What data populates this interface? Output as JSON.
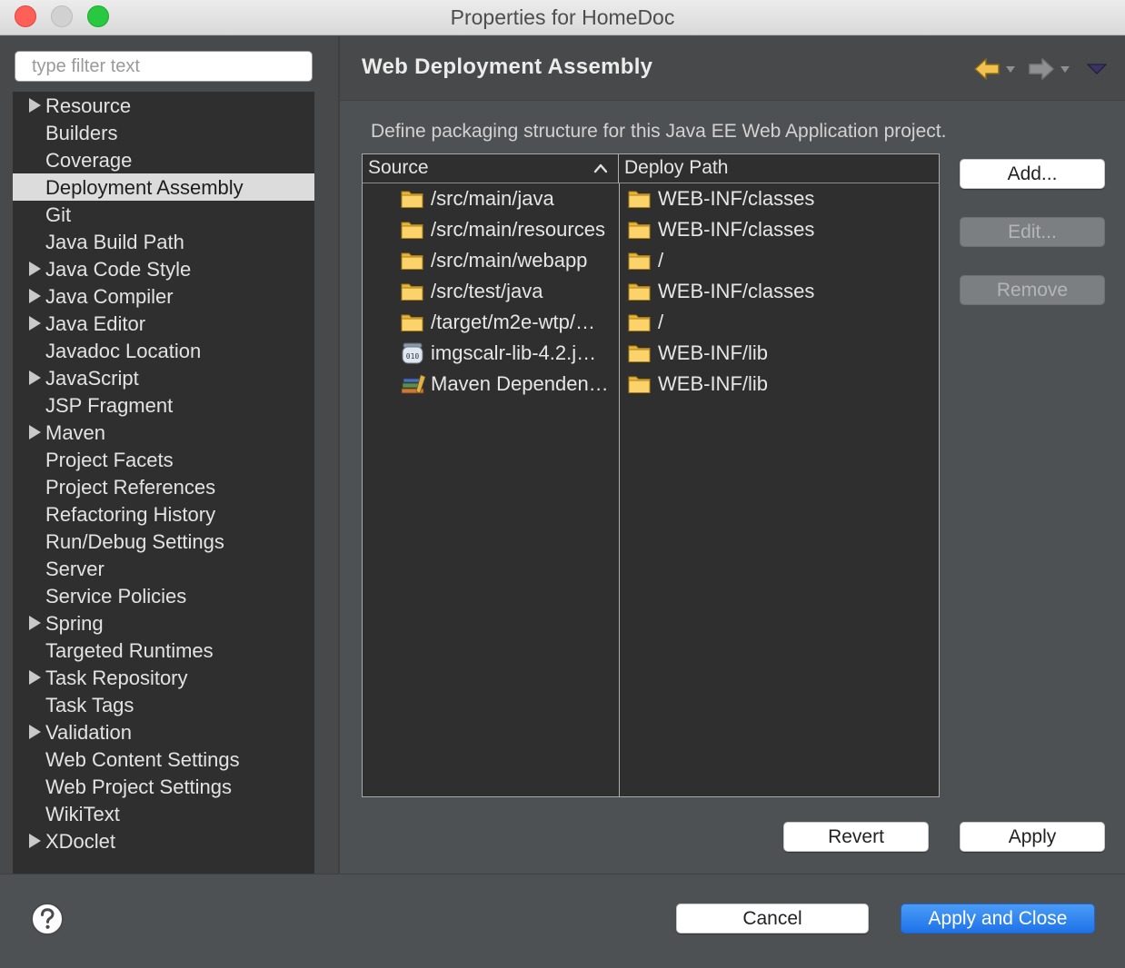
{
  "window": {
    "title": "Properties for HomeDoc"
  },
  "filter": {
    "placeholder": "type filter text",
    "value": ""
  },
  "sidebar": {
    "items": [
      {
        "label": "Resource",
        "expandable": true
      },
      {
        "label": "Builders",
        "expandable": false
      },
      {
        "label": "Coverage",
        "expandable": false
      },
      {
        "label": "Deployment Assembly",
        "expandable": false,
        "selected": true
      },
      {
        "label": "Git",
        "expandable": false
      },
      {
        "label": "Java Build Path",
        "expandable": false
      },
      {
        "label": "Java Code Style",
        "expandable": true
      },
      {
        "label": "Java Compiler",
        "expandable": true
      },
      {
        "label": "Java Editor",
        "expandable": true
      },
      {
        "label": "Javadoc Location",
        "expandable": false
      },
      {
        "label": "JavaScript",
        "expandable": true
      },
      {
        "label": "JSP Fragment",
        "expandable": false
      },
      {
        "label": "Maven",
        "expandable": true
      },
      {
        "label": "Project Facets",
        "expandable": false
      },
      {
        "label": "Project References",
        "expandable": false
      },
      {
        "label": "Refactoring History",
        "expandable": false
      },
      {
        "label": "Run/Debug Settings",
        "expandable": false
      },
      {
        "label": "Server",
        "expandable": false
      },
      {
        "label": "Service Policies",
        "expandable": false
      },
      {
        "label": "Spring",
        "expandable": true
      },
      {
        "label": "Targeted Runtimes",
        "expandable": false
      },
      {
        "label": "Task Repository",
        "expandable": true
      },
      {
        "label": "Task Tags",
        "expandable": false
      },
      {
        "label": "Validation",
        "expandable": true
      },
      {
        "label": "Web Content Settings",
        "expandable": false
      },
      {
        "label": "Web Project Settings",
        "expandable": false
      },
      {
        "label": "WikiText",
        "expandable": false
      },
      {
        "label": "XDoclet",
        "expandable": true
      }
    ]
  },
  "page": {
    "title": "Web Deployment Assembly",
    "description": "Define packaging structure for this Java EE Web Application project."
  },
  "table": {
    "columns": [
      "Source",
      "Deploy Path"
    ],
    "rows": [
      {
        "source": "/src/main/java",
        "source_icon": "folder-icon",
        "deploy": "WEB-INF/classes"
      },
      {
        "source": "/src/main/resources",
        "source_icon": "folder-icon",
        "deploy": "WEB-INF/classes"
      },
      {
        "source": "/src/main/webapp",
        "source_icon": "folder-icon",
        "deploy": "/"
      },
      {
        "source": "/src/test/java",
        "source_icon": "folder-icon",
        "deploy": "WEB-INF/classes"
      },
      {
        "source": "/target/m2e-wtp/…",
        "source_icon": "folder-icon",
        "deploy": "/"
      },
      {
        "source": "imgscalr-lib-4.2.j…",
        "source_icon": "jar-icon",
        "deploy": "WEB-INF/lib"
      },
      {
        "source": "Maven Dependen…",
        "source_icon": "library-icon",
        "deploy": "WEB-INF/lib"
      }
    ]
  },
  "buttons": {
    "add": "Add...",
    "edit": "Edit...",
    "remove": "Remove",
    "revert": "Revert",
    "apply": "Apply",
    "cancel": "Cancel",
    "apply_close": "Apply and Close"
  },
  "colors": {
    "accent": "#2a7ff0",
    "selection": "#dcdcdc",
    "tree_background": "#2f2f2f"
  }
}
